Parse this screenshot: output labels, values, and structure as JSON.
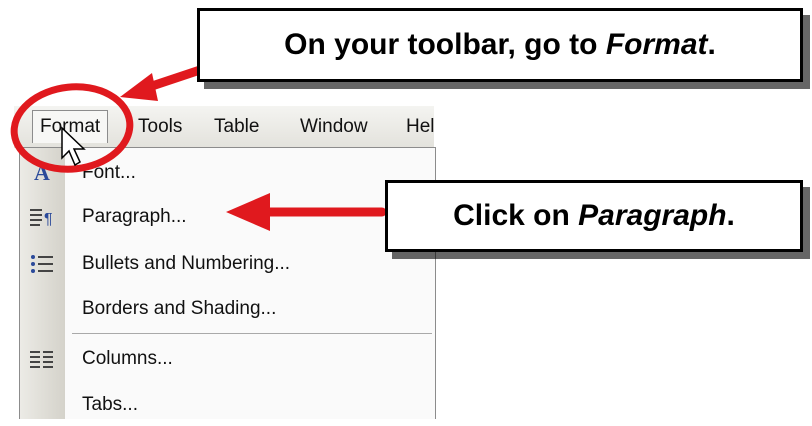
{
  "menubar": {
    "items": [
      {
        "label": "Format"
      },
      {
        "label": "Tools"
      },
      {
        "label": "Table"
      },
      {
        "label": "Window"
      },
      {
        "label": "Hel"
      }
    ]
  },
  "format_menu": {
    "items": [
      {
        "label": "Font...",
        "icon": "font-icon"
      },
      {
        "label": "Paragraph...",
        "icon": "paragraph-icon"
      },
      {
        "label": "Bullets and Numbering...",
        "icon": "bullets-icon"
      },
      {
        "label": "Borders and Shading...",
        "icon": ""
      },
      {
        "label": "Columns...",
        "icon": "columns-icon"
      },
      {
        "label": "Tabs...",
        "icon": ""
      }
    ]
  },
  "callouts": {
    "toolbar": {
      "prefix": "On your toolbar, go to ",
      "emphasis": "Format",
      "suffix": "."
    },
    "paragraph": {
      "prefix": "Click on ",
      "emphasis": "Paragraph",
      "suffix": "."
    }
  },
  "colors": {
    "annotation_red": "#e0191e",
    "menu_gutter": "#d4d2ca"
  }
}
